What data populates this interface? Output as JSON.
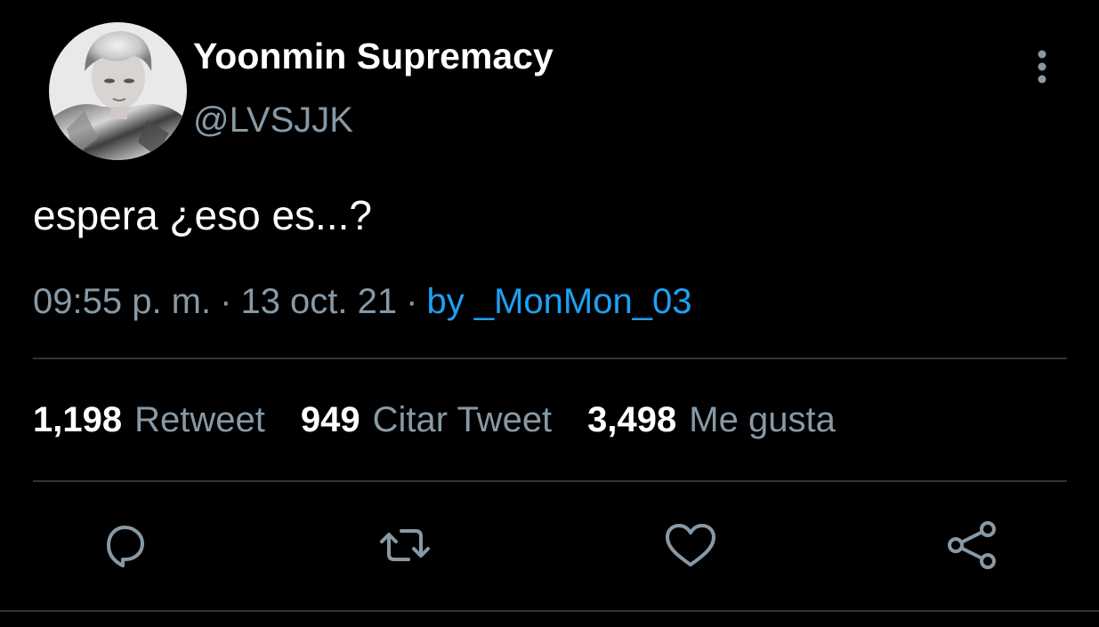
{
  "author": {
    "display_name": "Yoonmin Supremacy",
    "handle": "@LVSJJK",
    "avatar_icon": "profile-photo"
  },
  "tweet": {
    "text": "espera ¿eso es...?",
    "time": "09:55 p. m.",
    "separator": "·",
    "date": "13 oct. 21",
    "source": "by _MonMon_03"
  },
  "stats": {
    "retweets": {
      "count": "1,198",
      "label": "Retweet"
    },
    "quotes": {
      "count": "949",
      "label": "Citar Tweet"
    },
    "likes": {
      "count": "3,498",
      "label": "Me gusta"
    }
  },
  "actions": [
    "reply-icon",
    "retweet-icon",
    "heart-icon",
    "share-icon"
  ],
  "colors": {
    "background": "#000000",
    "text_primary": "#ffffff",
    "text_secondary": "#8899a6",
    "accent": "#1da1f2",
    "divider": "#2f3336"
  }
}
